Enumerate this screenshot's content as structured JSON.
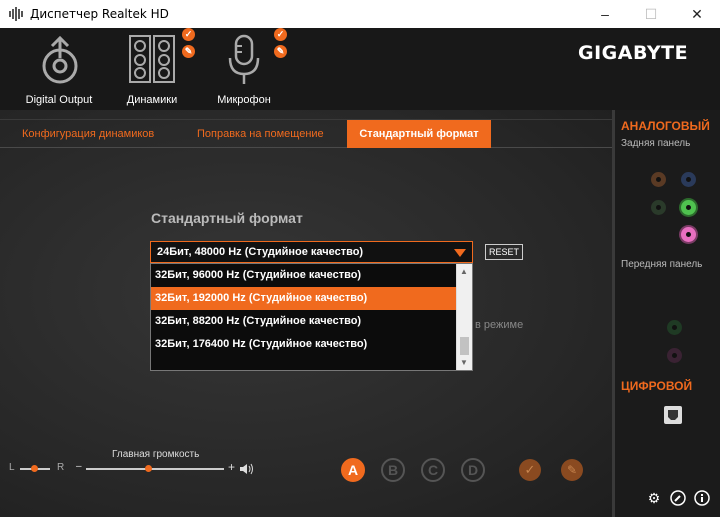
{
  "window": {
    "title": "Диспетчер Realtek HD"
  },
  "devices": [
    {
      "label": "Digital Output",
      "icon": "digital-output-icon"
    },
    {
      "label": "Динамики",
      "icon": "speakers-icon",
      "active": true
    },
    {
      "label": "Микрофон",
      "icon": "microphone-icon"
    }
  ],
  "brand": {
    "logo": "GIGABYTE"
  },
  "tabs": [
    {
      "label": "Конфигурация динамиков"
    },
    {
      "label": "Поправка на помещение"
    },
    {
      "label": "Стандартный формат",
      "active": true
    }
  ],
  "format": {
    "section_title": "Стандартный формат",
    "selected_value": "24Бит, 48000 Hz (Студийное качество)",
    "reset_label": "RESET",
    "options": [
      "32Бит, 96000 Hz (Студийное качество)",
      "32Бит, 192000 Hz (Студийное качество)",
      "32Бит, 88200 Hz (Студийное качество)",
      "32Бит, 176400 Hz (Студийное качество)"
    ],
    "highlighted_option": "32Бит, 192000 Hz (Студийное качество)",
    "partially_hidden_text": "в режиме"
  },
  "volume": {
    "balance_left": "L",
    "balance_right": "R",
    "label": "Главная громкость",
    "minus": "–",
    "plus": "+"
  },
  "effects": {
    "buttons": [
      "A",
      "B",
      "C",
      "D"
    ],
    "active": "A"
  },
  "sidebar": {
    "analog_title": "АНАЛОГОВЫЙ",
    "rear_panel": "Задняя панель",
    "front_panel": "Передняя панель",
    "digital_title": "ЦИФРОВОЙ"
  },
  "colors": {
    "accent": "#f06a1e",
    "background": "#2a2a2a",
    "sidebar": "#1b1b1b",
    "jack_green": "#4fc24f",
    "jack_pink": "#e86fc0"
  }
}
